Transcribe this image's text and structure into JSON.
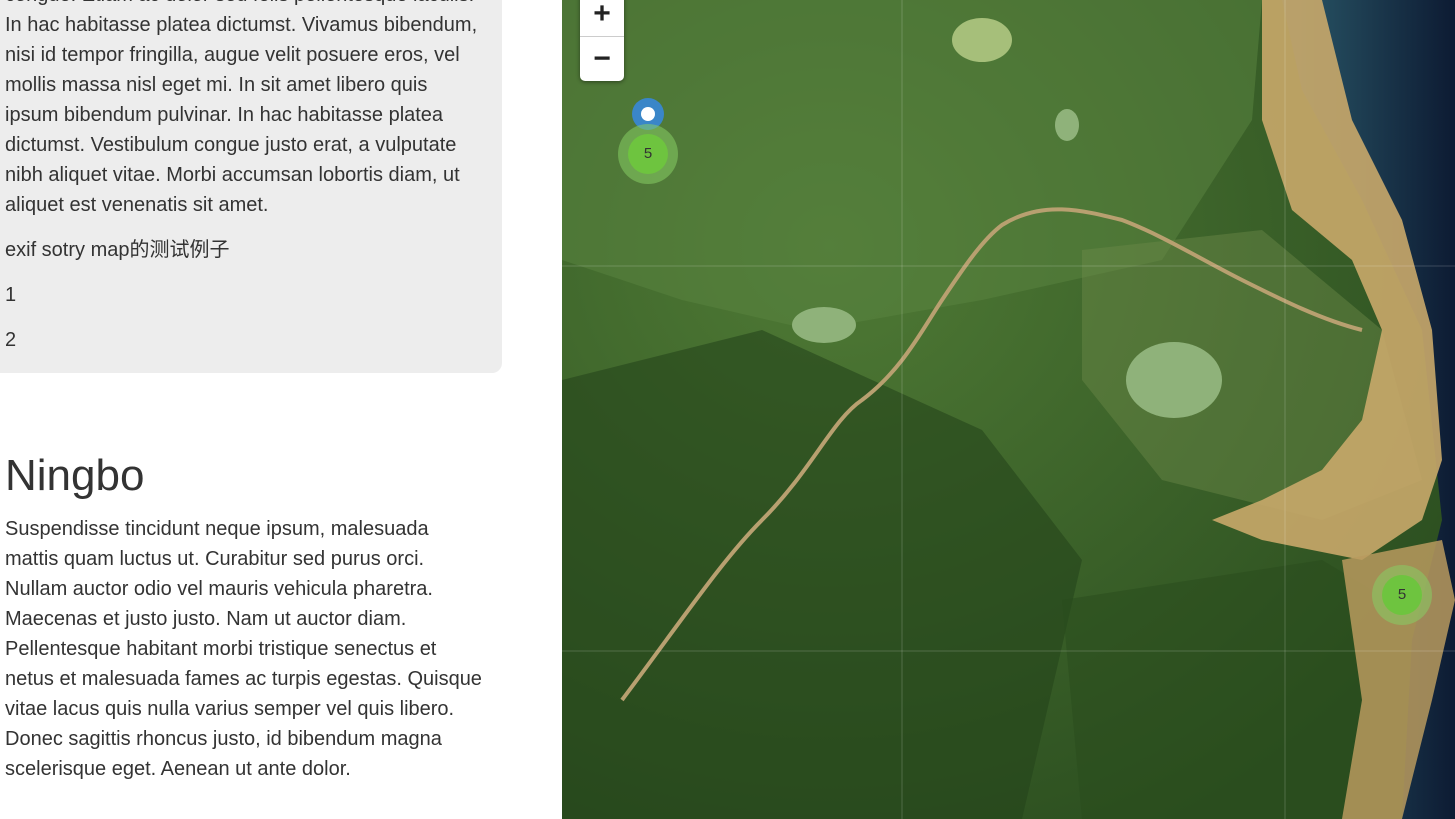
{
  "story": {
    "active_section": {
      "paragraph": "congue. Etiam ac dolor sed felis pellentesque iaculis. In hac habitasse platea dictumst. Vivamus bibendum, nisi id tempor fringilla, augue velit posuere eros, vel mollis massa nisl eget mi. In sit amet libero quis ipsum bibendum pulvinar. In hac habitasse platea dictumst. Vestibulum congue justo erat, a vulputate nibh aliquet vitae. Morbi accumsan lobortis diam, ut aliquet est venenatis sit amet.",
      "lines": [
        "exif sotry map的测试例子",
        "1",
        "2"
      ]
    },
    "next_section": {
      "title": "Ningbo",
      "paragraph": "Suspendisse tincidunt neque ipsum, malesuada mattis quam luctus ut. Curabitur sed purus orci. Nullam auctor odio vel mauris vehicula pharetra. Maecenas et justo justo. Nam ut auctor diam. Pellentesque habitant morbi tristique senectus et netus et malesuada fames ac turpis egestas. Quisque vitae lacus quis nulla varius semper vel quis libero. Donec sagittis rhoncus justo, id bibendum magna scelerisque eget. Aenean ut ante dolor."
    }
  },
  "map": {
    "zoom_in_label": "+",
    "zoom_out_label": "−",
    "clusters": [
      {
        "count": "5"
      },
      {
        "count": "5"
      }
    ],
    "colors": {
      "cluster_core": "#6ec43f",
      "marker": "#3a86c8",
      "land": "#3f6a2c",
      "river_silt": "#c9a86a",
      "sea": "#0d1b33"
    },
    "marker_icon": "map-pin-icon"
  }
}
